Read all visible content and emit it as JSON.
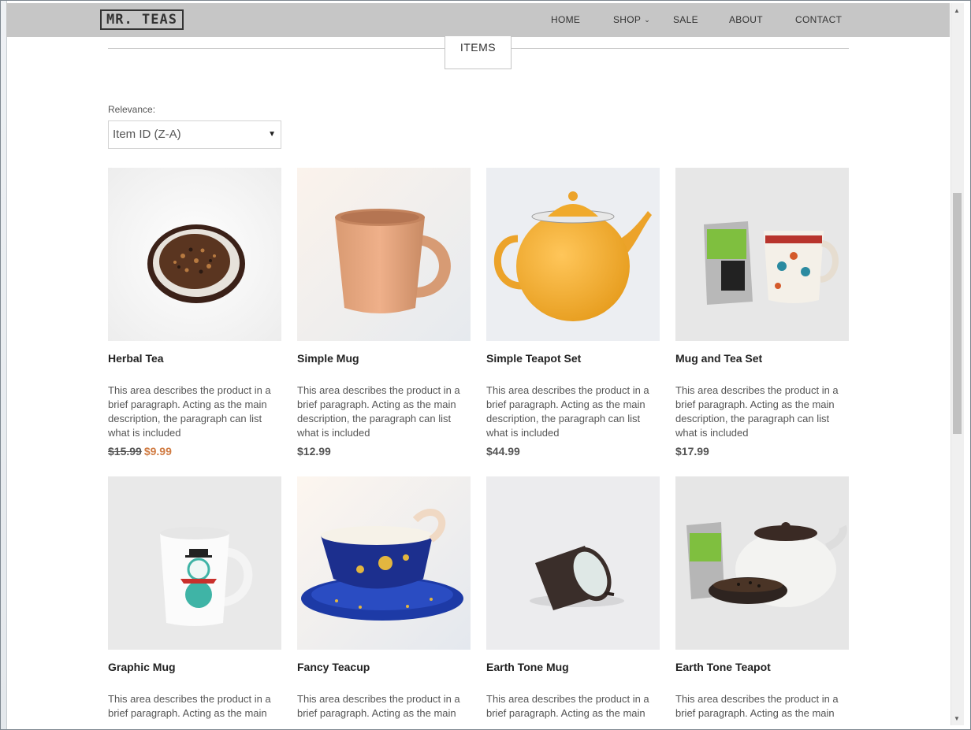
{
  "brand": {
    "logo": "MR. TEAS"
  },
  "nav": {
    "items": [
      {
        "label": "HOME"
      },
      {
        "label": "SHOP",
        "has_dropdown": true
      },
      {
        "label": "SALE"
      },
      {
        "label": "ABOUT"
      },
      {
        "label": "CONTACT"
      }
    ]
  },
  "section": {
    "title": "ITEMS"
  },
  "sort": {
    "label": "Relevance:",
    "selected": "Item ID (Z-A)"
  },
  "products": [
    {
      "name": "Herbal Tea",
      "description": "This area describes the product in a brief paragraph. Acting as the main description, the paragraph can list what is included",
      "old_price": "$15.99",
      "price": "$9.99"
    },
    {
      "name": "Simple Mug",
      "description": "This area describes the product in a brief paragraph. Acting as the main description, the paragraph can list what is included",
      "price": "$12.99"
    },
    {
      "name": "Simple Teapot Set",
      "description": "This area describes the product in a brief paragraph. Acting as the main description, the paragraph can list what is included",
      "price": "$44.99"
    },
    {
      "name": "Mug and Tea Set",
      "description": "This area describes the product in a brief paragraph. Acting as the main description, the paragraph can list what is included",
      "price": "$17.99"
    },
    {
      "name": "Graphic Mug",
      "description": "This area describes the product in a brief paragraph. Acting as the main"
    },
    {
      "name": "Fancy Teacup",
      "description": "This area describes the product in a brief paragraph. Acting as the main"
    },
    {
      "name": "Earth Tone Mug",
      "description": "This area describes the product in a brief paragraph. Acting as the main"
    },
    {
      "name": "Earth Tone Teapot",
      "description": "This area describes the product in a brief paragraph. Acting as the main"
    }
  ],
  "colors": {
    "navbar": "#c6c6c6",
    "sale_price": "#d07b42",
    "text": "#555555"
  }
}
